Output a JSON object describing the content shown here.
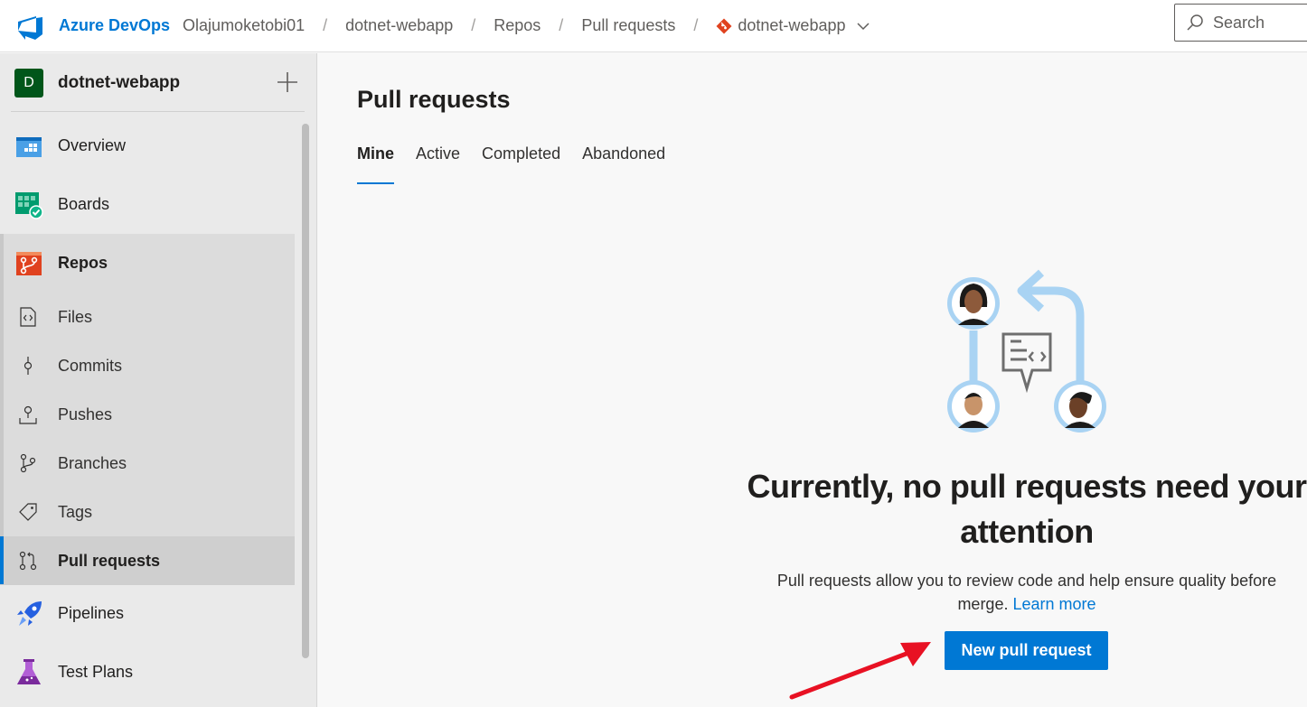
{
  "header": {
    "brand": "Azure DevOps",
    "organization": "Olajumoketobi01",
    "project": "dotnet-webapp",
    "section": "Repos",
    "page": "Pull requests",
    "repo": "dotnet-webapp",
    "search_placeholder": "Search"
  },
  "sidebar": {
    "project_initial": "D",
    "project_name": "dotnet-webapp",
    "items": [
      {
        "label": "Overview",
        "icon": "overview-icon"
      },
      {
        "label": "Boards",
        "icon": "boards-icon"
      },
      {
        "label": "Repos",
        "icon": "repos-icon"
      }
    ],
    "repos_items": [
      {
        "label": "Files",
        "icon": "files-icon"
      },
      {
        "label": "Commits",
        "icon": "commits-icon"
      },
      {
        "label": "Pushes",
        "icon": "pushes-icon"
      },
      {
        "label": "Branches",
        "icon": "branches-icon"
      },
      {
        "label": "Tags",
        "icon": "tags-icon"
      },
      {
        "label": "Pull requests",
        "icon": "pull-requests-icon",
        "selected": true
      }
    ],
    "bottom_items": [
      {
        "label": "Pipelines",
        "icon": "pipelines-icon"
      },
      {
        "label": "Test Plans",
        "icon": "test-plans-icon"
      }
    ]
  },
  "main": {
    "title": "Pull requests",
    "tabs": [
      {
        "label": "Mine",
        "active": true
      },
      {
        "label": "Active"
      },
      {
        "label": "Completed"
      },
      {
        "label": "Abandoned"
      }
    ],
    "empty_state": {
      "title": "Currently, no pull requests need your attention",
      "description": "Pull requests allow you to review code and help ensure quality before merge.",
      "learn_more": "Learn more",
      "button": "New pull request"
    }
  },
  "colors": {
    "accent": "#0078d4",
    "annotation_arrow": "#e81123"
  }
}
